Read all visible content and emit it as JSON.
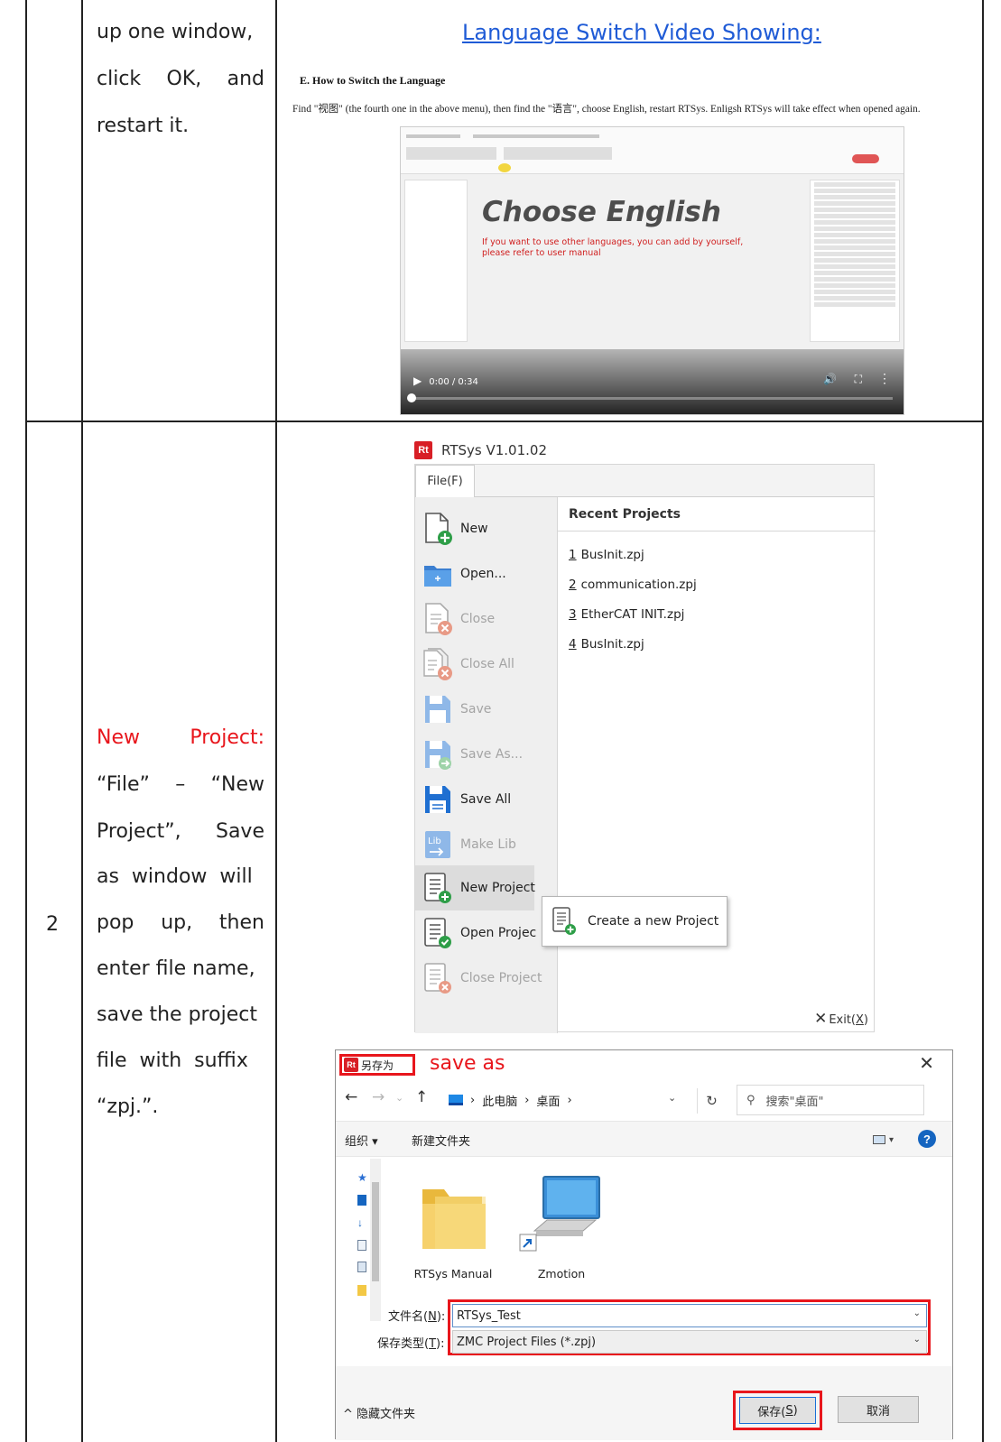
{
  "row1": {
    "instruction_lines": [
      "up one window,",
      "click  OK,  and",
      "restart it."
    ],
    "video_link": "Language Switch Video Showing: ",
    "doc_heading": "E.   How to Switch the Language",
    "doc_paragraph": "Find \"视图\" (the fourth one in the above menu), then find the \"语言\", choose English, restart RTSys. Enligsh RTSys will take effect when opened again.",
    "video": {
      "title": "Choose English",
      "subtitle_line1": "If you want to use other languages, you can add by yourself,",
      "subtitle_line2": "please refer to user manual",
      "time": "0:00 / 0:34",
      "progress_fraction": 0.0
    }
  },
  "row2": {
    "number": "2",
    "instruction_lines": [
      {
        "a": "New",
        "b": "Project:"
      },
      {
        "a": "“File”",
        "b": "–",
        "c": "“New"
      },
      {
        "a": "Project”,",
        "b": "Save"
      },
      {
        "a": "as  window  will"
      },
      {
        "a": "pop",
        "b": "up,",
        "c": "then"
      },
      {
        "a": "enter file name,"
      },
      {
        "a": "save the project"
      },
      {
        "a": "file  with  suffix"
      },
      {
        "a": "“zpj.”."
      }
    ],
    "rtsys": {
      "window_title": "RTSys V1.01.02",
      "file_tab": "File(F)",
      "menu": [
        {
          "label": "New",
          "icon": "new-file-icon",
          "disabled": false
        },
        {
          "label": "Open...",
          "icon": "open-folder-icon",
          "disabled": false
        },
        {
          "label": "Close",
          "icon": "close-file-icon",
          "disabled": true
        },
        {
          "label": "Close All",
          "icon": "close-all-icon",
          "disabled": true
        },
        {
          "label": "Save",
          "icon": "save-icon",
          "disabled": true
        },
        {
          "label": "Save As...",
          "icon": "save-as-icon",
          "disabled": true
        },
        {
          "label": "Save All",
          "icon": "save-all-icon",
          "disabled": false
        },
        {
          "label": "Make Lib",
          "icon": "make-lib-icon",
          "disabled": true
        },
        {
          "label": "New Project",
          "icon": "new-project-icon",
          "disabled": false,
          "highlighted": true
        },
        {
          "label": "Open Projec",
          "icon": "open-project-icon",
          "disabled": false
        },
        {
          "label": "Close Project",
          "icon": "close-project-icon",
          "disabled": true
        }
      ],
      "recent_title": "Recent Projects",
      "recent": [
        {
          "num": "1",
          "name": "BusInit.zpj"
        },
        {
          "num": "2",
          "name": "communication.zpj"
        },
        {
          "num": "3",
          "name": "EtherCAT INIT.zpj"
        },
        {
          "num": "4",
          "name": "BusInit.zpj"
        }
      ],
      "tooltip": "Create a new Project",
      "exit_label": "Exit(",
      "exit_key": "X",
      "exit_close": ")"
    },
    "save_dialog": {
      "title": "另存为",
      "annotation": "save as",
      "path": [
        "此电脑",
        "桌面"
      ],
      "search_placeholder": "搜索\"桌面\"",
      "organize": "组织 ▾",
      "new_folder": "新建文件夹",
      "items": [
        {
          "name": "RTSys Manual",
          "icon": "folder-icon"
        },
        {
          "name": "Zmotion",
          "icon": "computer-shortcut-icon"
        }
      ],
      "filename_label": "文件名(",
      "filename_key": "N",
      "filename_close": "):",
      "filename_value": "RTSys_Test",
      "filetype_label": "保存类型(",
      "filetype_key": "T",
      "filetype_close": "):",
      "filetype_value": "ZMC Project Files (*.zpj)",
      "hide_folders": "^ 隐藏文件夹",
      "save_label": "保存(",
      "save_key": "S",
      "save_close": ")",
      "cancel_label": "取消"
    }
  },
  "colors": {
    "accent_red": "#e8161c",
    "link_blue": "#1f5bd6",
    "rtsys_logo": "#d81f26"
  }
}
